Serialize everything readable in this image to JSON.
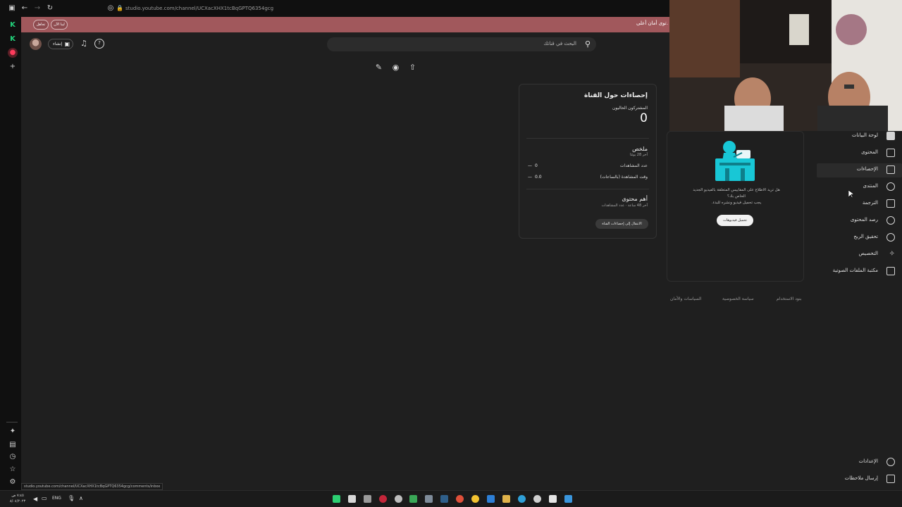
{
  "browser": {
    "url": "studio.youtube.com/channel/UCXacXHX1tcBqGPTQ6354gcg",
    "status_url": "studio.youtube.com/channel/UCXacXHX1tcBqGPTQ6354gcg/comments/inbox"
  },
  "banner": {
    "text": "توى أمان أعلى.",
    "btn_now": "ليبا الآن",
    "btn_later": "تجاهل"
  },
  "header": {
    "search_placeholder": "البحث في قناتك",
    "create_label": "إنشاء"
  },
  "analytics": {
    "title": "إحصاءات حول القناة",
    "subs_label": "المشتركون الحاليون",
    "subs_value": "0",
    "summary_title": "ملخص",
    "summary_period": "آخر 28 يومًا",
    "views_label": "عدد المشاهدات",
    "views_value": "0",
    "views_delta": "—",
    "watch_label": "وقت المشاهدة (بالساعات)",
    "watch_value": "0.0",
    "watch_delta": "—",
    "top_title": "أهم محتوى",
    "top_sub": "آخر 48 ساعة · عدد المشاهدات",
    "button": "الانتقال إلى إحصاءات القناة"
  },
  "promo": {
    "line1": "هل تريد الاطلاع على المقاييس المتعلقة بالفيديو الجديد",
    "line2": "الخاص بك؟",
    "line3": "يجب تحميل فيديو ونشره للبدء.",
    "button": "تحميل فيديوهات"
  },
  "sidebar": {
    "items": [
      {
        "label": "لوحة البيانات",
        "icon": "dashboard-icon"
      },
      {
        "label": "المحتوى",
        "icon": "content-icon"
      },
      {
        "label": "الإحصاءات",
        "icon": "analytics-icon"
      },
      {
        "label": "المنتدى",
        "icon": "community-icon"
      },
      {
        "label": "الترجمة",
        "icon": "subtitles-icon"
      },
      {
        "label": "رصد المحتوى",
        "icon": "copyright-icon"
      },
      {
        "label": "تحقيق الربح",
        "icon": "monetization-icon"
      },
      {
        "label": "التخصيص",
        "icon": "customization-icon"
      },
      {
        "label": "مكتبة الملفات الصوتية",
        "icon": "audio-library-icon"
      }
    ],
    "settings": "الإعدادات",
    "feedback": "إرسال ملاحظات"
  },
  "footer": {
    "terms": "بنود الاستخدام",
    "privacy": "سياسة الخصوصية",
    "policies": "السياسات والأمان"
  },
  "taskbar": {
    "lang": "ENG",
    "time": "٧:٤٥ ص",
    "date": "٨/٠٤/٢٠٢٣"
  },
  "colors": {
    "banner": "#a1585c",
    "background": "#1f1f1f",
    "promo_illustration": "#18c7d6"
  }
}
